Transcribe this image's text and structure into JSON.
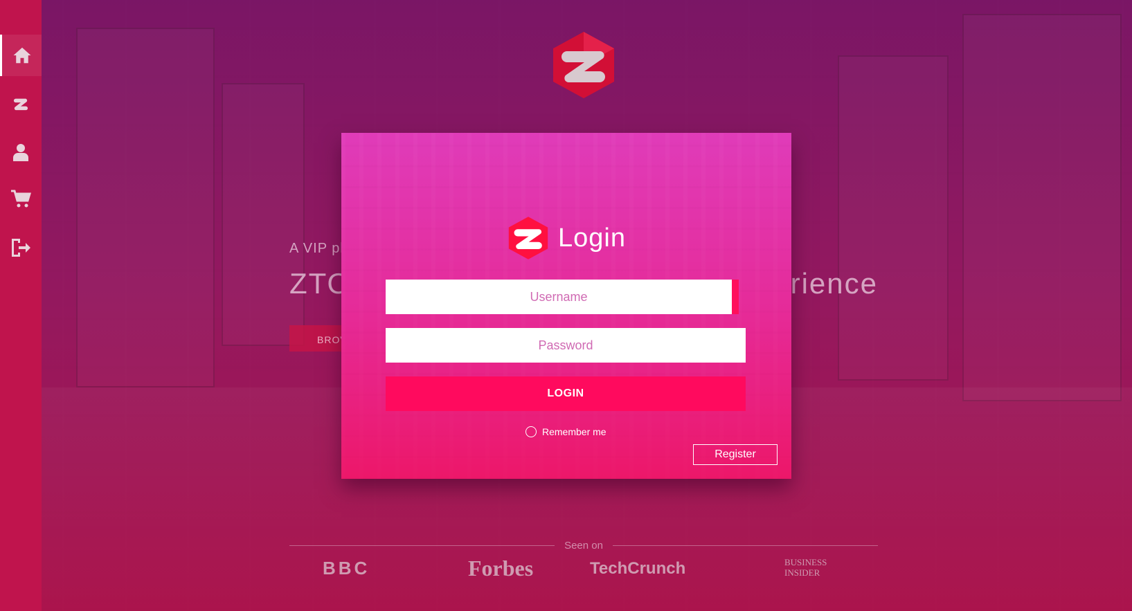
{
  "sidebar": {
    "items": [
      {
        "icon": "home-icon"
      },
      {
        "icon": "ztore-logo-icon"
      },
      {
        "icon": "user-icon"
      },
      {
        "icon": "cart-icon"
      },
      {
        "icon": "logout-icon"
      }
    ]
  },
  "hero": {
    "subtitle": "A VIP pl",
    "title_left": "ZTO",
    "title_right": "rience",
    "button_label": "BROV"
  },
  "seen_on": {
    "label": "Seen on",
    "brands": [
      "BBC",
      "Forbes",
      "TechCrunch",
      "BUSINESS INSIDER"
    ]
  },
  "login_modal": {
    "title": "Login",
    "username_placeholder": "Username",
    "password_placeholder": "Password",
    "login_button": "LOGIN",
    "remember_label": "Remember me",
    "register_button": "Register"
  },
  "colors": {
    "accent": "#ff0a5e",
    "sidebar": "#c0144d",
    "logo_red": "#e0103a"
  }
}
